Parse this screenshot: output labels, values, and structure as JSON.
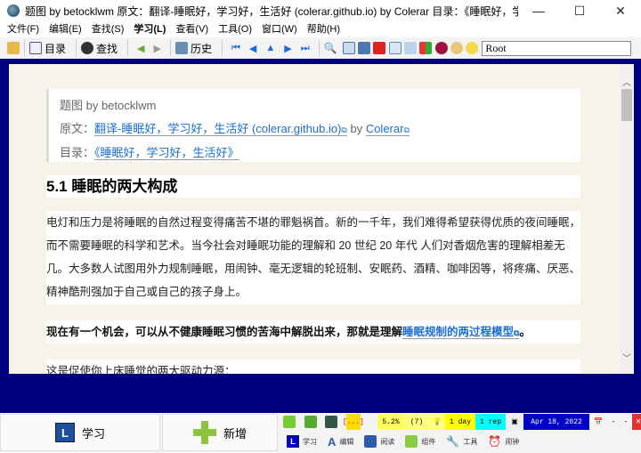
{
  "window": {
    "title": "题图 by betocklwm 原文：翻译-睡眠好，学习好，生活好 (colerar.github.io) by Colerar 目录：《睡眠好，学习好，生活好》5.1 ...",
    "minimize": "—",
    "maximize": "☐",
    "close": "✕"
  },
  "menu": [
    "文件(F)",
    "编辑(E)",
    "查找(S)",
    "学习(L)",
    "查看(V)",
    "工具(O)",
    "窗口(W)",
    "帮助(H)"
  ],
  "toolbar": {
    "contents": "目录",
    "search": "查找",
    "history": "历史",
    "root": "Root"
  },
  "article": {
    "meta_title": "题图 by betocklwm",
    "source_label": "原文：",
    "source_link": "翻译-睡眠好，学习好，生活好 (colerar.github.io)",
    "by": " by ",
    "author_link": "Colerar",
    "toc_label": "目录：",
    "toc_link": "《睡眠好，学习好，生活好》",
    "heading": "5.1 睡眠的两大构成",
    "para1": "电灯和压力是将睡眠的自然过程变得痛苦不堪的罪魁祸首。新的一千年，我们难得希望获得优质的夜间睡眠，而不需要睡眠的科学和艺术。当今社会对睡眠功能的理解和 20 世纪 20 年代 人们对香烟危害的理解相差无几。大多数人试图用外力规制睡眠，用闹钟、毫无逻辑的轮班制、安眠药、酒精、咖啡因等，将疼痛、厌恶、精神酷刑强加于自己或自己的孩子身上。",
    "para2_text": "现在有一个机会，可以从不健康睡眠习惯的苦海中解脱出来，那就是理解",
    "para2_link": "睡眠规制的两过程模型",
    "para2_end": "。",
    "para3": "这是促使你上床睡觉的两大驱动力源："
  },
  "bottom": {
    "learn": "学习",
    "add": "新增",
    "percent": "5.2%",
    "count": "(7)",
    "interval": "1 day",
    "reps": "1 rep",
    "date": "Apr 18, 2022",
    "dash1": "-",
    "dash2": "-",
    "flag": "[...]"
  },
  "tabs": [
    "学习",
    "编辑",
    "阅读",
    "组件",
    "工具",
    "闹钟"
  ]
}
